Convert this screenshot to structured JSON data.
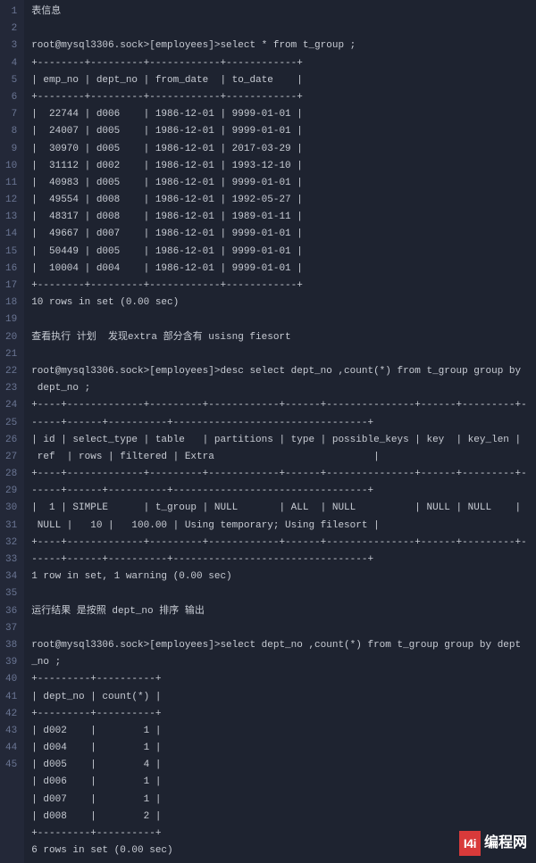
{
  "lines": [
    {
      "n": "1",
      "t": "表信息"
    },
    {
      "n": "2",
      "t": ""
    },
    {
      "n": "3",
      "t": "root@mysql3306.sock>[employees]>select * from t_group ;"
    },
    {
      "n": "4",
      "t": "+--------+---------+------------+------------+"
    },
    {
      "n": "5",
      "t": "| emp_no | dept_no | from_date  | to_date    |"
    },
    {
      "n": "6",
      "t": "+--------+---------+------------+------------+"
    },
    {
      "n": "7",
      "t": "|  22744 | d006    | 1986-12-01 | 9999-01-01 |"
    },
    {
      "n": "8",
      "t": "|  24007 | d005    | 1986-12-01 | 9999-01-01 |"
    },
    {
      "n": "9",
      "t": "|  30970 | d005    | 1986-12-01 | 2017-03-29 |"
    },
    {
      "n": "10",
      "t": "|  31112 | d002    | 1986-12-01 | 1993-12-10 |"
    },
    {
      "n": "11",
      "t": "|  40983 | d005    | 1986-12-01 | 9999-01-01 |"
    },
    {
      "n": "12",
      "t": "|  49554 | d008    | 1986-12-01 | 1992-05-27 |"
    },
    {
      "n": "13",
      "t": "|  48317 | d008    | 1986-12-01 | 1989-01-11 |"
    },
    {
      "n": "14",
      "t": "|  49667 | d007    | 1986-12-01 | 9999-01-01 |"
    },
    {
      "n": "15",
      "t": "|  50449 | d005    | 1986-12-01 | 9999-01-01 |"
    },
    {
      "n": "16",
      "t": "|  10004 | d004    | 1986-12-01 | 9999-01-01 |"
    },
    {
      "n": "17",
      "t": "+--------+---------+------------+------------+"
    },
    {
      "n": "18",
      "t": "10 rows in set (0.00 sec)"
    },
    {
      "n": "19",
      "t": ""
    },
    {
      "n": "20",
      "t": "查看执行 计划  发现extra 部分含有 usisng fiesort"
    },
    {
      "n": "21",
      "t": ""
    },
    {
      "n": "22",
      "t": "root@mysql3306.sock>[employees]>desc select dept_no ,count(*) from t_group group by "
    },
    {
      "n": "23",
      "t": " dept_no ;"
    },
    {
      "n": "24",
      "t": "+----+-------------+---------+------------+------+---------------+------+---------+-"
    },
    {
      "n": "25",
      "t": "-----+------+----------+---------------------------------+"
    },
    {
      "n": "26",
      "t": "| id | select_type | table   | partitions | type | possible_keys | key  | key_len |"
    },
    {
      "n": "27",
      "t": " ref  | rows | filtered | Extra                           |"
    },
    {
      "n": "28",
      "t": "+----+-------------+---------+------------+------+---------------+------+---------+-"
    },
    {
      "n": "29",
      "t": "-----+------+----------+---------------------------------+"
    },
    {
      "n": "30",
      "t": "|  1 | SIMPLE      | t_group | NULL       | ALL  | NULL          | NULL | NULL    |"
    },
    {
      "n": "31",
      "t": " NULL |   10 |   100.00 | Using temporary; Using filesort |"
    },
    {
      "n": "32",
      "t": "+----+-------------+---------+------------+------+---------------+------+---------+-"
    },
    {
      "n": "33",
      "t": "-----+------+----------+---------------------------------+"
    },
    {
      "n": "34",
      "t": "1 row in set, 1 warning (0.00 sec)"
    },
    {
      "n": "35",
      "t": ""
    },
    {
      "n": "36",
      "t": "运行结果 是按照 dept_no 排序 输出"
    },
    {
      "n": "37",
      "t": ""
    },
    {
      "n": "38",
      "t": "root@mysql3306.sock>[employees]>select dept_no ,count(*) from t_group group by dept"
    },
    {
      "n": "39",
      "t": "_no ;"
    },
    {
      "n": "40",
      "t": "+---------+----------+"
    },
    {
      "n": "41",
      "t": "| dept_no | count(*) |"
    },
    {
      "n": "42",
      "t": "+---------+----------+"
    },
    {
      "n": "43",
      "t": "| d002    |        1 |"
    },
    {
      "n": "44",
      "t": "| d004    |        1 |"
    },
    {
      "n": "45",
      "t": "| d005    |        4 |"
    },
    {
      "n": "",
      "t": "| d006    |        1 |"
    },
    {
      "n": "",
      "t": "| d007    |        1 |"
    },
    {
      "n": "",
      "t": "| d008    |        2 |"
    },
    {
      "n": "",
      "t": "+---------+----------+"
    },
    {
      "n": "",
      "t": "6 rows in set (0.00 sec)"
    }
  ],
  "chart_data_tables": {
    "t_group": {
      "type": "table",
      "columns": [
        "emp_no",
        "dept_no",
        "from_date",
        "to_date"
      ],
      "rows": [
        [
          22744,
          "d006",
          "1986-12-01",
          "9999-01-01"
        ],
        [
          24007,
          "d005",
          "1986-12-01",
          "9999-01-01"
        ],
        [
          30970,
          "d005",
          "1986-12-01",
          "2017-03-29"
        ],
        [
          31112,
          "d002",
          "1986-12-01",
          "1993-12-10"
        ],
        [
          40983,
          "d005",
          "1986-12-01",
          "9999-01-01"
        ],
        [
          49554,
          "d008",
          "1986-12-01",
          "1992-05-27"
        ],
        [
          48317,
          "d008",
          "1986-12-01",
          "1989-01-11"
        ],
        [
          49667,
          "d007",
          "1986-12-01",
          "9999-01-01"
        ],
        [
          50449,
          "d005",
          "1986-12-01",
          "9999-01-01"
        ],
        [
          10004,
          "d004",
          "1986-12-01",
          "9999-01-01"
        ]
      ],
      "summary": "10 rows in set (0.00 sec)"
    },
    "explain_plan": {
      "type": "table",
      "columns": [
        "id",
        "select_type",
        "table",
        "partitions",
        "type",
        "possible_keys",
        "key",
        "key_len",
        "ref",
        "rows",
        "filtered",
        "Extra"
      ],
      "rows": [
        [
          1,
          "SIMPLE",
          "t_group",
          "NULL",
          "ALL",
          "NULL",
          "NULL",
          "NULL",
          "NULL",
          10,
          100.0,
          "Using temporary; Using filesort"
        ]
      ],
      "summary": "1 row in set, 1 warning (0.00 sec)"
    },
    "group_count": {
      "type": "table",
      "columns": [
        "dept_no",
        "count(*)"
      ],
      "rows": [
        [
          "d002",
          1
        ],
        [
          "d004",
          1
        ],
        [
          "d005",
          4
        ],
        [
          "d006",
          1
        ],
        [
          "d007",
          1
        ],
        [
          "d008",
          2
        ]
      ],
      "summary": "6 rows in set (0.00 sec)"
    }
  },
  "logo": {
    "badge": "I4i",
    "text": "编程网"
  }
}
